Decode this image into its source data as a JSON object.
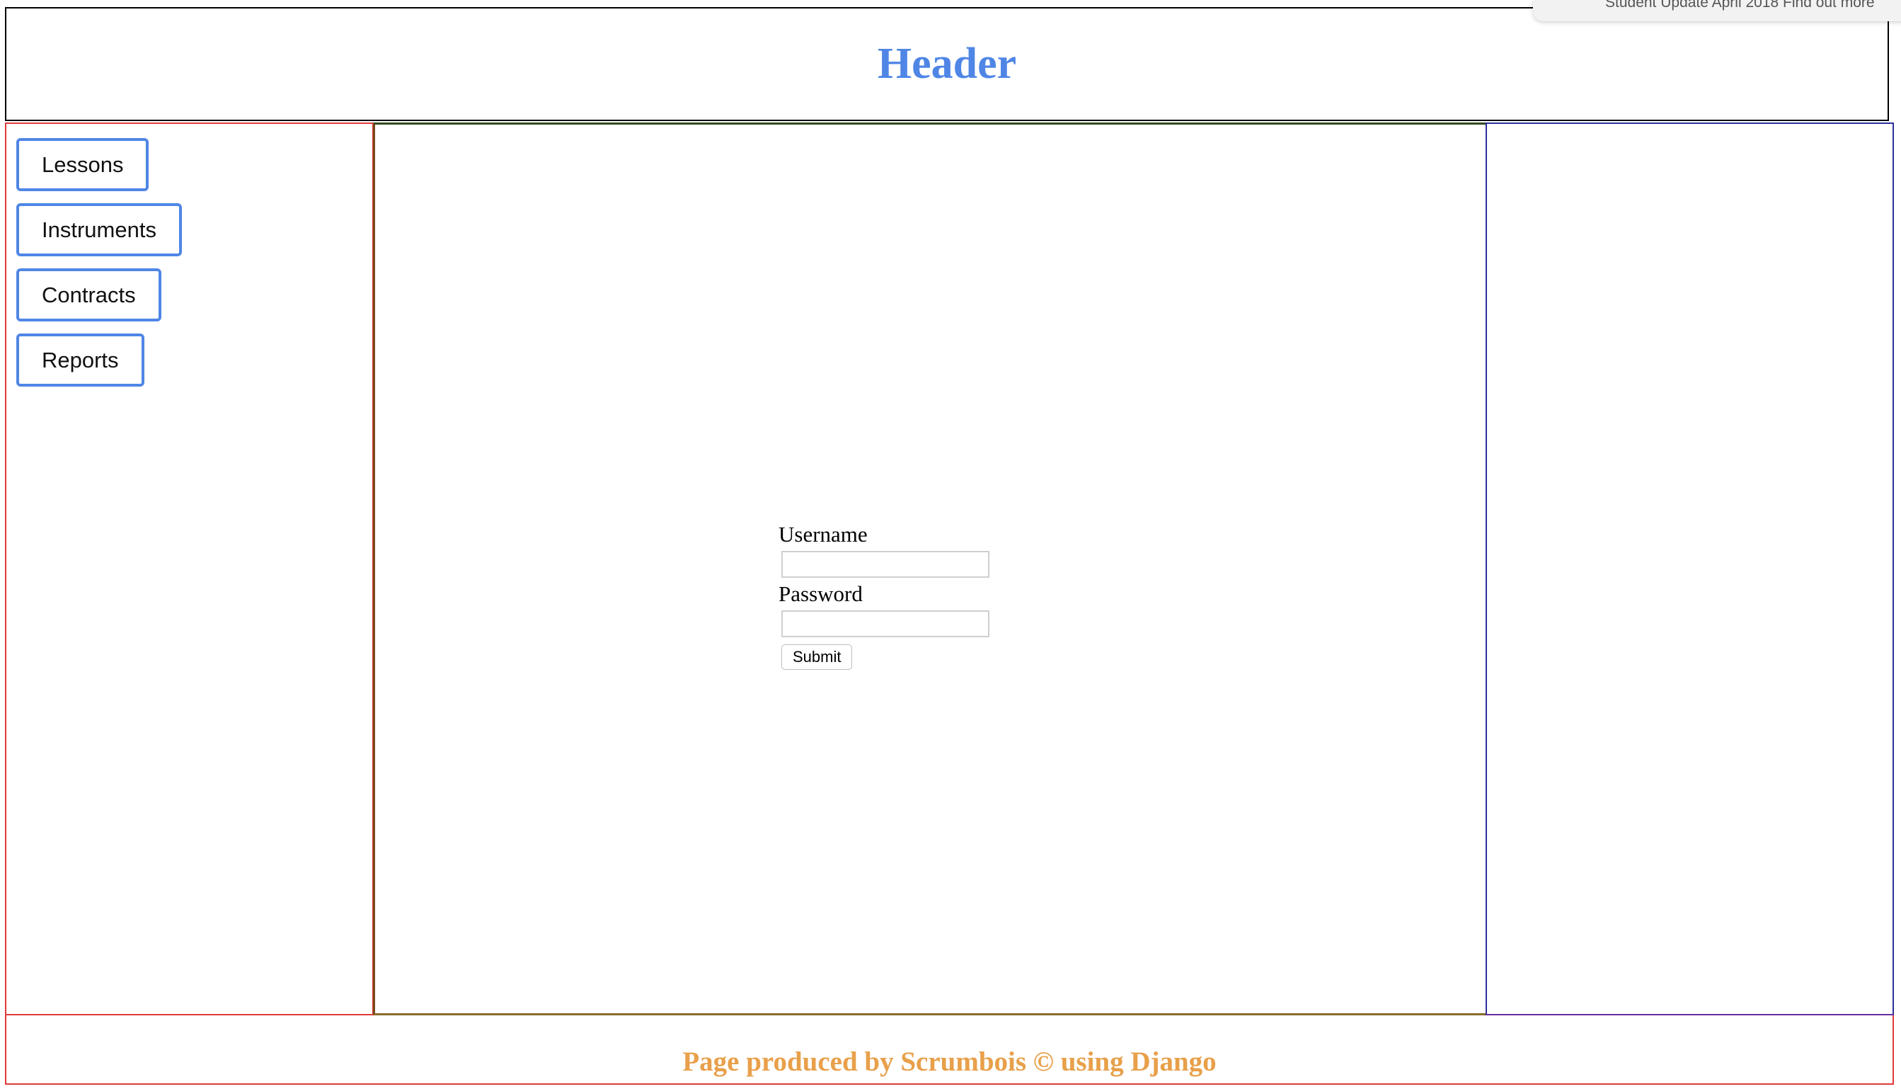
{
  "header": {
    "title": "Header"
  },
  "notification": {
    "text": "Student Update April 2018 Find out more"
  },
  "sidebar": {
    "items": [
      {
        "label": "Lessons"
      },
      {
        "label": "Instruments"
      },
      {
        "label": "Contracts"
      },
      {
        "label": "Reports"
      }
    ]
  },
  "login": {
    "username_label": "Username",
    "username_value": "",
    "password_label": "Password",
    "password_value": "",
    "submit_label": "Submit"
  },
  "footer": {
    "text": "Page produced by Scrumbois © using Django"
  },
  "colors": {
    "header_title": "#4f86e6",
    "nav_border": "#4f86e6",
    "sidebar_border": "#e03a3a",
    "right_border": "#2c2f9a",
    "footer_text": "#e8a04a"
  }
}
